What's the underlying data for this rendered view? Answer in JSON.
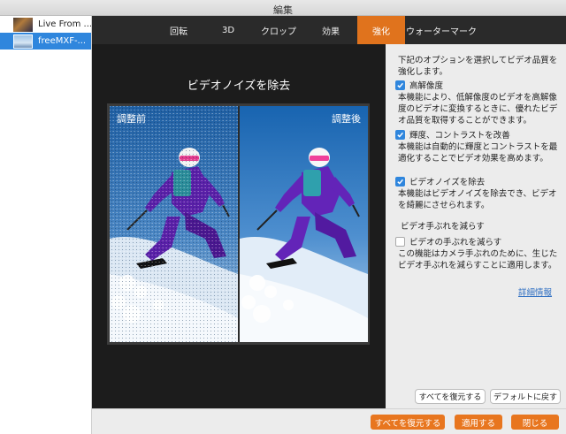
{
  "window": {
    "title": "編集"
  },
  "sidebar": {
    "files": [
      {
        "name": "Live From ...",
        "selected": false,
        "thumb": "video-thumbnail"
      },
      {
        "name": "freeMXF-...",
        "selected": true,
        "thumb": "video-thumbnail"
      }
    ]
  },
  "tabs": [
    {
      "label": "回転",
      "active": false
    },
    {
      "label": "3D",
      "active": false
    },
    {
      "label": "クロップ",
      "active": false
    },
    {
      "label": "効果",
      "active": false
    },
    {
      "label": "強化",
      "active": true
    },
    {
      "label": "ウォーターマーク",
      "active": false
    }
  ],
  "preview": {
    "title": "ビデオノイズを除去",
    "before_label": "調整前",
    "after_label": "調整後"
  },
  "settings": {
    "intro": "下記のオプションを選択してビデオ品質を強化します。",
    "upscale": {
      "label": "高解像度",
      "checked": true,
      "desc": "本機能により、低解像度のビデオを高解像度のビデオに変換するときに、優れたビデオ品質を取得することができます。"
    },
    "brightness": {
      "label": "輝度、コントラストを改善",
      "checked": true,
      "desc": "本機能は自動的に輝度とコントラストを最適化することでビデオ効果を高めます。"
    },
    "denoise": {
      "label": "ビデオノイズを除去",
      "checked": true,
      "desc": "本機能はビデオノイズを除去でき、ビデオを綺麗にさせられます。"
    },
    "shake_heading": "ビデオ手ぶれを減らす",
    "shake": {
      "label": "ビデオの手ぶれを減らす",
      "checked": false,
      "desc": "この機能はカメラ手ぶれのために、生じたビデオ手ぶれを減らすことに適用します。"
    },
    "details_link": "詳細情報",
    "restore_all_label": "すべてを復元する",
    "default_label": "デフォルトに戻す"
  },
  "bottom": {
    "restore_all_label": "すべてを復元する",
    "apply_label": "適用する",
    "close_label": "閉じる"
  },
  "colors": {
    "accent": "#e0731d",
    "selection": "#2f86dd",
    "link": "#2f6fc2"
  }
}
